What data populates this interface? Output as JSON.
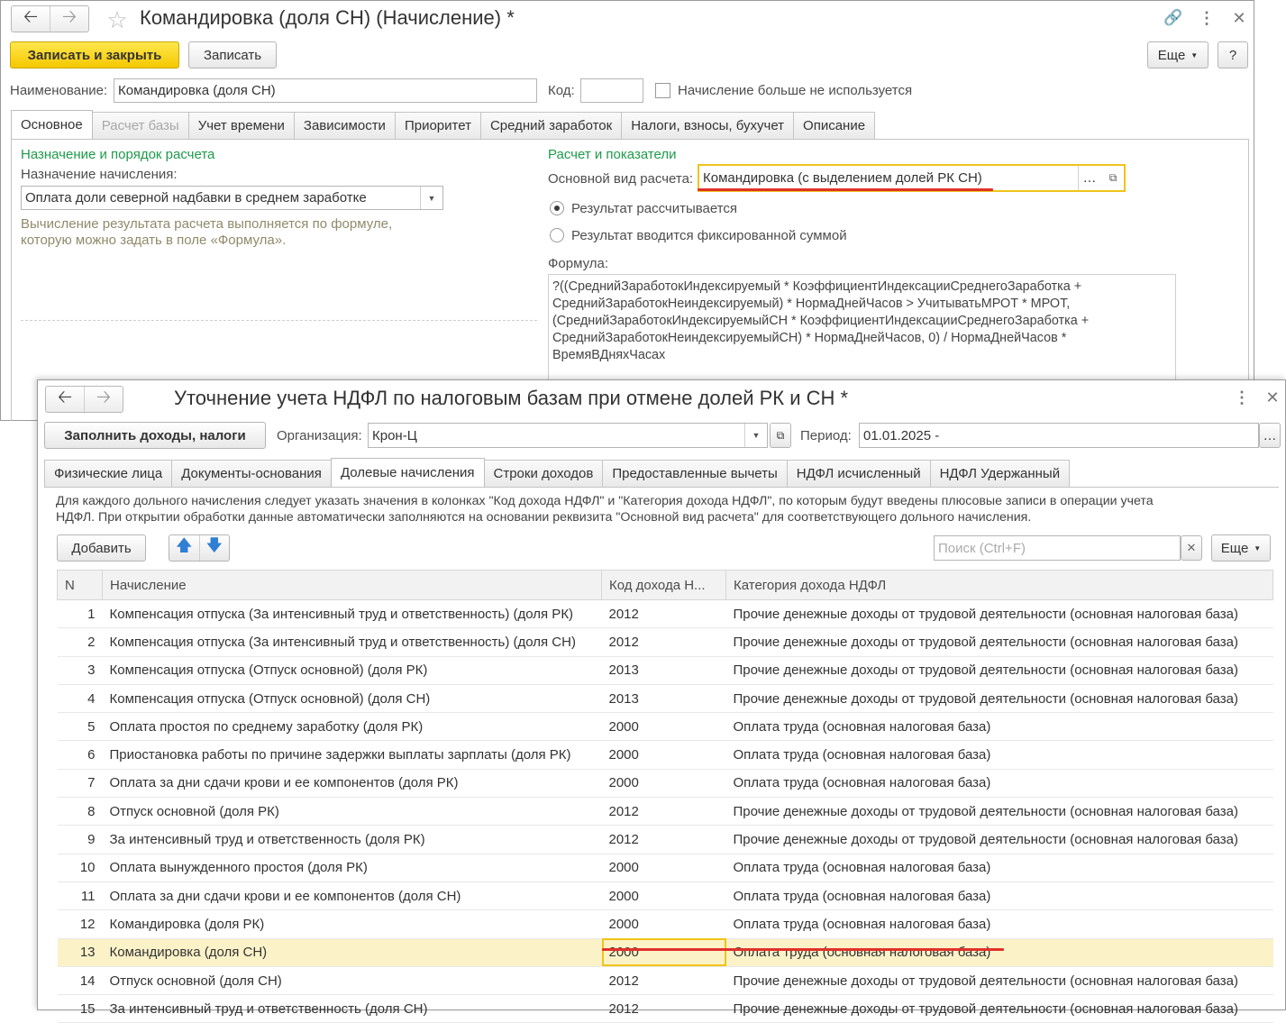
{
  "win1": {
    "title": "Командировка (доля СН) (Начисление) *",
    "save_close": "Записать и закрыть",
    "save": "Записать",
    "more": "Еще",
    "help": "?",
    "name_label": "Наименование:",
    "name_value": "Командировка (доля СН)",
    "code_label": "Код:",
    "code_value": "",
    "unused_label": "Начисление больше не используется",
    "tabs": [
      "Основное",
      "Расчет базы",
      "Учет времени",
      "Зависимости",
      "Приоритет",
      "Средний заработок",
      "Налоги, взносы, бухучет",
      "Описание"
    ],
    "left": {
      "section": "Назначение и порядок расчета",
      "purpose_label": "Назначение начисления:",
      "purpose_value": "Оплата доли северной надбавки в среднем заработке",
      "hint1": "Вычисление результата расчета выполняется по формуле,",
      "hint2": "которую можно задать в поле «Формула»."
    },
    "right": {
      "section": "Расчет и показатели",
      "main_type_label": "Основной вид расчета:",
      "main_type_value": "Командировка (с выделением долей РК СН)",
      "radio_calc": "Результат рассчитывается",
      "radio_fixed": "Результат вводится фиксированной суммой",
      "formula_label": "Формула:",
      "formula_lines": [
        "?((СреднийЗаработокИндексируемый * КоэффициентИндексацииСреднегоЗаработка +",
        "СреднийЗаработокНеиндексируемый) * НормаДнейЧасов > УчитыватьМРОТ * МРОТ,",
        "(СреднийЗаработокИндексируемыйСН * КоэффициентИндексацииСреднегоЗаработка +",
        "СреднийЗаработокНеиндексируемыйСН) * НормаДнейЧасов, 0) / НормаДнейЧасов *",
        "ВремяВДняхЧасах"
      ]
    }
  },
  "win2": {
    "title": "Уточнение учета НДФЛ по налоговым базам при отмене долей РК и СН *",
    "fill_button": "Заполнить доходы, налоги",
    "org_label": "Организация:",
    "org_value": "Крон-Ц",
    "period_label": "Период:",
    "period_value": "01.01.2025 -",
    "tabs": [
      "Физические лица",
      "Документы-основания",
      "Долевые начисления",
      "Строки доходов",
      "Предоставленные вычеты",
      "НДФЛ исчисленный",
      "НДФЛ Удержанный"
    ],
    "info1": "Для каждого дольного начисления следует указать значения в колонках \"Код дохода НДФЛ\" и \"Категория дохода НДФЛ\", по которым будут введены плюсовые записи в операции учета",
    "info2": "НДФЛ. При открытии обработки данные автоматически заполняются на основании реквизита \"Основной вид расчета\" для соответствующего дольного начисления.",
    "add_button": "Добавить",
    "search_placeholder": "Поиск (Ctrl+F)",
    "more": "Еще",
    "columns": [
      "N",
      "Начисление",
      "Код дохода Н...",
      "Категория дохода НДФЛ"
    ],
    "rows": [
      {
        "n": "1",
        "name": "Компенсация отпуска (За интенсивный труд и ответственность) (доля РК)",
        "code": "2012",
        "cat": "Прочие денежные доходы от трудовой деятельности (основная налоговая база)"
      },
      {
        "n": "2",
        "name": "Компенсация отпуска (За интенсивный труд и ответственность) (доля СН)",
        "code": "2012",
        "cat": "Прочие денежные доходы от трудовой деятельности (основная налоговая база)"
      },
      {
        "n": "3",
        "name": "Компенсация отпуска (Отпуск основной) (доля РК)",
        "code": "2013",
        "cat": "Прочие денежные доходы от трудовой деятельности (основная налоговая база)"
      },
      {
        "n": "4",
        "name": "Компенсация отпуска (Отпуск основной) (доля СН)",
        "code": "2013",
        "cat": "Прочие денежные доходы от трудовой деятельности (основная налоговая база)"
      },
      {
        "n": "5",
        "name": "Оплата простоя по среднему заработку (доля РК)",
        "code": "2000",
        "cat": "Оплата труда (основная налоговая база)"
      },
      {
        "n": "6",
        "name": "Приостановка работы по причине задержки выплаты зарплаты (доля РК)",
        "code": "2000",
        "cat": "Оплата труда (основная налоговая база)"
      },
      {
        "n": "7",
        "name": "Оплата за дни сдачи крови и ее компонентов (доля РК)",
        "code": "2000",
        "cat": "Оплата труда (основная налоговая база)"
      },
      {
        "n": "8",
        "name": "Отпуск основной (доля РК)",
        "code": "2012",
        "cat": "Прочие денежные доходы от трудовой деятельности (основная налоговая база)"
      },
      {
        "n": "9",
        "name": "За интенсивный труд и ответственность (доля РК)",
        "code": "2012",
        "cat": "Прочие денежные доходы от трудовой деятельности (основная налоговая база)"
      },
      {
        "n": "10",
        "name": "Оплата вынужденного простоя (доля РК)",
        "code": "2000",
        "cat": "Оплата труда (основная налоговая база)"
      },
      {
        "n": "11",
        "name": "Оплата за дни сдачи крови и ее компонентов (доля СН)",
        "code": "2000",
        "cat": "Оплата труда (основная налоговая база)"
      },
      {
        "n": "12",
        "name": "Командировка (доля РК)",
        "code": "2000",
        "cat": "Оплата труда (основная налоговая база)"
      },
      {
        "n": "13",
        "name": "Командировка (доля СН)",
        "code": "2000",
        "cat": "Оплата труда (основная налоговая база)",
        "selected": true
      },
      {
        "n": "14",
        "name": "Отпуск основной (доля СН)",
        "code": "2012",
        "cat": "Прочие денежные доходы от трудовой деятельности (основная налоговая база)"
      },
      {
        "n": "15",
        "name": "За интенсивный труд и ответственность (доля СН)",
        "code": "2012",
        "cat": "Прочие денежные доходы от трудовой деятельности (основная налоговая база)"
      }
    ]
  },
  "colors": {
    "accent_yellow": "#f5c800",
    "section_green": "#1e9a4a",
    "underline_red": "#e0322a",
    "selected_row": "#fcf2c8"
  },
  "icons": [
    "back-arrow-icon",
    "forward-arrow-icon",
    "star-icon",
    "link-icon",
    "kebab-menu-icon",
    "close-icon",
    "arrow-up-icon",
    "arrow-down-icon",
    "open-icon",
    "ellipsis-icon"
  ]
}
